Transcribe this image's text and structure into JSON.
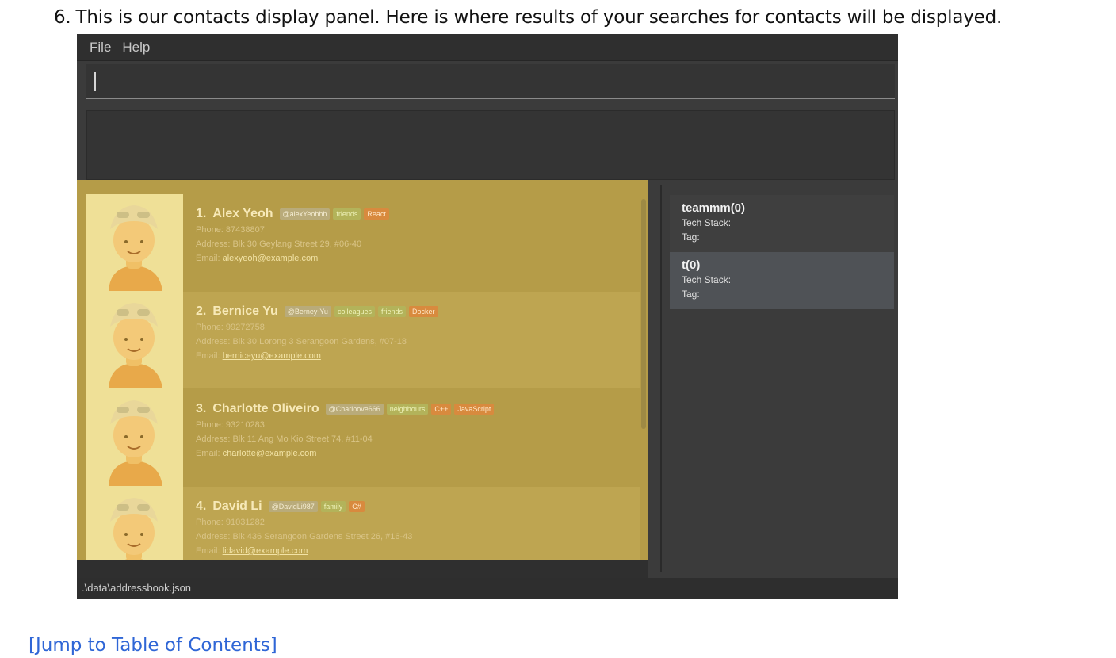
{
  "doc": {
    "step_number": "6.",
    "step_text": "This is our contacts display panel. Here is where results of your searches for contacts will be displayed.",
    "toc_link": "[Jump to Table of Contents]"
  },
  "app": {
    "menu": [
      "File",
      "Help"
    ],
    "command_box": {
      "value": "",
      "placeholder": ""
    },
    "status_path": ".\\data\\addressbook.json",
    "contacts": [
      {
        "index": "1.",
        "name": "Alex Yeoh",
        "github": "@alexYeohhh",
        "tags": [
          "friends"
        ],
        "tech": [
          "React"
        ],
        "phone": "Phone: 87438807",
        "address": "Address: Blk 30 Geylang Street 29, #06-40",
        "email_label": "Email:",
        "email": "alexyeoh@example.com"
      },
      {
        "index": "2.",
        "name": "Bernice Yu",
        "github": "@Berney-Yu",
        "tags": [
          "colleagues",
          "friends"
        ],
        "tech": [
          "Docker"
        ],
        "phone": "Phone: 99272758",
        "address": "Address: Blk 30 Lorong 3 Serangoon Gardens, #07-18",
        "email_label": "Email:",
        "email": "berniceyu@example.com"
      },
      {
        "index": "3.",
        "name": "Charlotte Oliveiro",
        "github": "@Charloove666",
        "tags": [
          "neighbours"
        ],
        "tech": [
          "C++",
          "JavaScript"
        ],
        "phone": "Phone: 93210283",
        "address": "Address: Blk 11 Ang Mo Kio Street 74, #11-04",
        "email_label": "Email:",
        "email": "charlotte@example.com"
      },
      {
        "index": "4.",
        "name": "David Li",
        "github": "@DavidLi987",
        "tags": [
          "family"
        ],
        "tech": [
          "C#"
        ],
        "phone": "Phone: 91031282",
        "address": "Address: Blk 436 Serangoon Gardens Street 26, #16-43",
        "email_label": "Email:",
        "email": "lidavid@example.com"
      }
    ],
    "teams": [
      {
        "name": "teammm(0)",
        "tech_stack": "Tech Stack:",
        "tag": "Tag:"
      },
      {
        "name": "t(0)",
        "tech_stack": "Tech Stack:",
        "tag": "Tag:"
      }
    ]
  },
  "colors": {
    "highlight": "#b59c48",
    "avatar_bg": "#efe097",
    "link": "#2f66d6",
    "app_bg": "#3b3b3b"
  }
}
